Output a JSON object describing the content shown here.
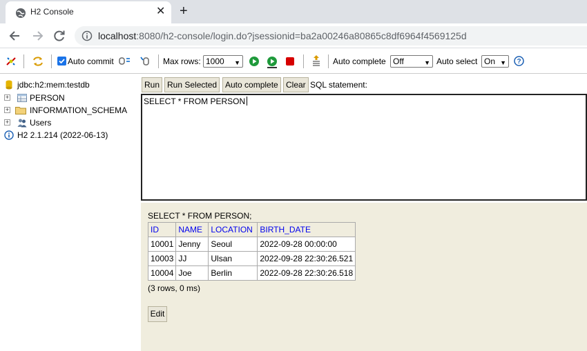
{
  "browser": {
    "tab_title": "H2 Console",
    "tab_close": "✕",
    "new_tab": "+",
    "url_host": "localhost",
    "url_rest": ":8080/h2-console/login.do?jsessionid=ba2a00246a80865c8df6964f4569125d"
  },
  "toolbar": {
    "auto_commit_label": "Auto commit",
    "max_rows_label": "Max rows:",
    "max_rows_value": "1000",
    "auto_complete_label": "Auto complete",
    "auto_complete_value": "Off",
    "auto_select_label": "Auto select",
    "auto_select_value": "On",
    "help_label": "?"
  },
  "tree": {
    "connection": "jdbc:h2:mem:testdb",
    "items": [
      {
        "label": "PERSON",
        "icon": "table-icon"
      },
      {
        "label": "INFORMATION_SCHEMA",
        "icon": "folder-icon"
      },
      {
        "label": "Users",
        "icon": "users-icon"
      }
    ],
    "version": "H2 2.1.214 (2022-06-13)"
  },
  "query": {
    "buttons": {
      "run": "Run",
      "run_selected": "Run Selected",
      "auto_complete": "Auto complete",
      "clear": "Clear"
    },
    "sql_label": "SQL statement:",
    "sql_text": "SELECT * FROM PERSON"
  },
  "result": {
    "statement": "SELECT * FROM PERSON;",
    "columns": [
      "ID",
      "NAME",
      "LOCATION",
      "BIRTH_DATE"
    ],
    "rows": [
      [
        "10001",
        "Jenny",
        "Seoul",
        "2022-09-28 00:00:00"
      ],
      [
        "10003",
        "JJ",
        "Ulsan",
        "2022-09-28 22:30:26.521"
      ],
      [
        "10004",
        "Joe",
        "Berlin",
        "2022-09-28 22:30:26.518"
      ]
    ],
    "meta": "(3 rows, 0 ms)",
    "edit_label": "Edit"
  },
  "colors": {
    "accent": "#1a73e8",
    "result_bg": "#f0edde",
    "header_link": "#0000ee"
  }
}
